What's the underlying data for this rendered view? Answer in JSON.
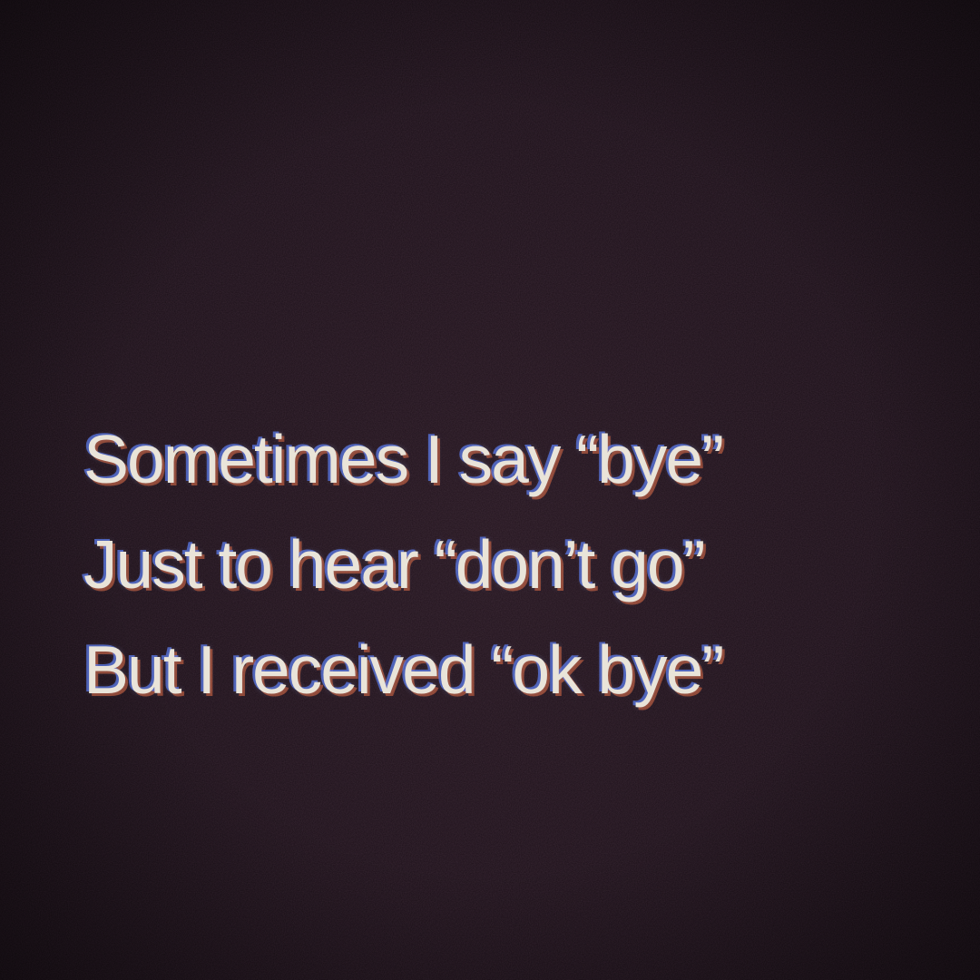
{
  "quote": {
    "lines": [
      "Sometimes I say “bye”",
      "Just to hear “don’t go”",
      "But I received “ok bye”"
    ]
  },
  "colors": {
    "background": "#1a0f17",
    "text": "#e9e4d9",
    "chromatic_blue": "#5a78e6",
    "chromatic_orange": "#e16e46"
  }
}
